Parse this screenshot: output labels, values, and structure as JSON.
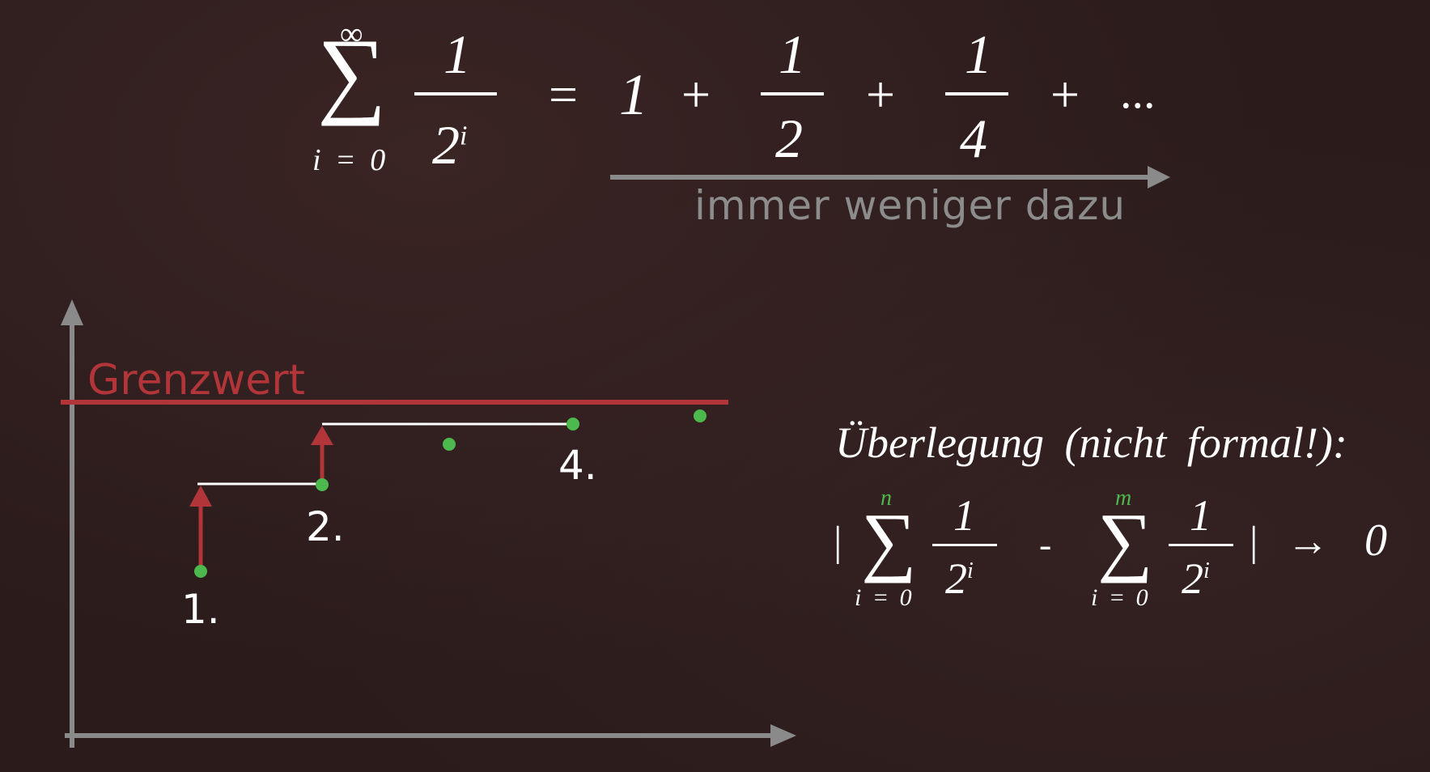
{
  "top_formula": {
    "sum_upper": "∞",
    "sum_symbol": "∑",
    "sum_lower": "i = 0",
    "frac_num": "1",
    "frac_den_base": "2",
    "frac_den_exp": "i",
    "equals": "=",
    "term1": "1",
    "plus1": "+",
    "term2_num": "1",
    "term2_den": "2",
    "plus2": "+",
    "term3_num": "1",
    "term3_den": "4",
    "plus3": "+",
    "ellipsis": "..."
  },
  "arrow_caption": "immer weniger dazu",
  "graph": {
    "limit_label": "Grenzwert",
    "labels": [
      "1.",
      "2.",
      "4."
    ],
    "colors": {
      "limit": "#b2353a",
      "points": "#4db84d",
      "axis": "#8a8a8a",
      "step_line": "#ffffff"
    }
  },
  "consideration": {
    "title": "Überlegung (nicht formal!):",
    "bar_left": "|",
    "sum1_upper": "n",
    "sum1_symbol": "∑",
    "sum1_lower": "i = 0",
    "sum1_num": "1",
    "sum1_den_base": "2",
    "sum1_den_exp": "i",
    "minus": "-",
    "sum2_upper": "m",
    "sum2_symbol": "∑",
    "sum2_lower": "i = 0",
    "sum2_num": "1",
    "sum2_den_base": "2",
    "sum2_den_exp": "i",
    "bar_right": "|",
    "arrow": "→",
    "limit_value": "0"
  }
}
